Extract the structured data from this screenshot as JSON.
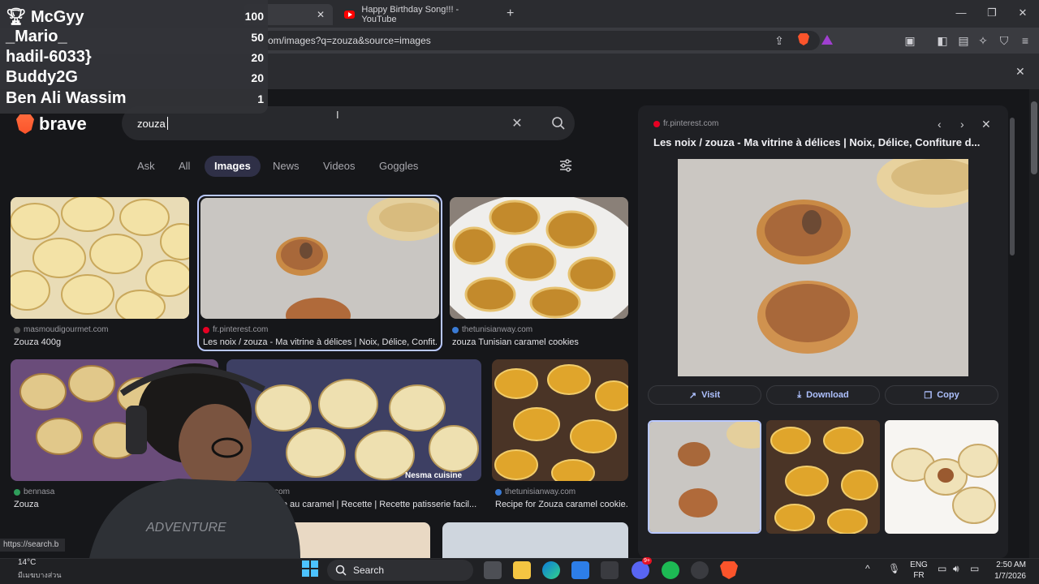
{
  "browser": {
    "tabs": [
      {
        "title": ""
      },
      {
        "title": "Happy Birthday Song!!! - YouTube"
      }
    ],
    "url": "om/images?q=zouza&source=images",
    "status_url": "https://search.b"
  },
  "leaderboard": [
    {
      "name": "McGyy",
      "score": "100"
    },
    {
      "name": "_Mario_",
      "score": "50"
    },
    {
      "name": "hadil-6033}",
      "score": "20"
    },
    {
      "name": "Buddy2G",
      "score": "20"
    },
    {
      "name": "Ben Ali Wassim",
      "score": "1"
    }
  ],
  "search": {
    "brand": "brave",
    "query": "zouza",
    "filters": [
      "Ask",
      "All",
      "Images",
      "News",
      "Videos",
      "Goggles"
    ],
    "active_filter": "Images"
  },
  "results": [
    {
      "source": "masmoudigourmet.com",
      "caption": "Zouza 400g"
    },
    {
      "source": "fr.pinterest.com",
      "caption": "Les noix / zouza - Ma vitrine à délices | Noix, Délice, Confit..."
    },
    {
      "source": "thetunisianway.com",
      "caption": "zouza Tunisian caramel cookies"
    },
    {
      "source": "bennasa",
      "caption": "Zouza"
    },
    {
      "source": "erest.com",
      "caption": "nisienne au caramel | Recette | Recette patisserie facil..."
    },
    {
      "source": "thetunisianway.com",
      "caption": "Recipe for Zouza caramel cookie..."
    }
  ],
  "watermark": "Nesma cuisine",
  "preview": {
    "source": "fr.pinterest.com",
    "title": "Les noix / zouza - Ma vitrine à délices | Noix, Délice, Confiture d...",
    "buttons": {
      "visit": "Visit",
      "download": "Download",
      "copy": "Copy"
    }
  },
  "taskbar": {
    "temp": "14°C",
    "weather_sub": "มีเมฆบางส่วน",
    "search_label": "Search",
    "lang_top": "ENG",
    "lang_bottom": "FR",
    "time": "2:50 AM",
    "date": "1/7/2026",
    "discord_badge": "9+"
  },
  "colors": {
    "accent": "#aec1ff",
    "brave_orange": "#fb542b",
    "selected_border": "#b9c8ff"
  }
}
